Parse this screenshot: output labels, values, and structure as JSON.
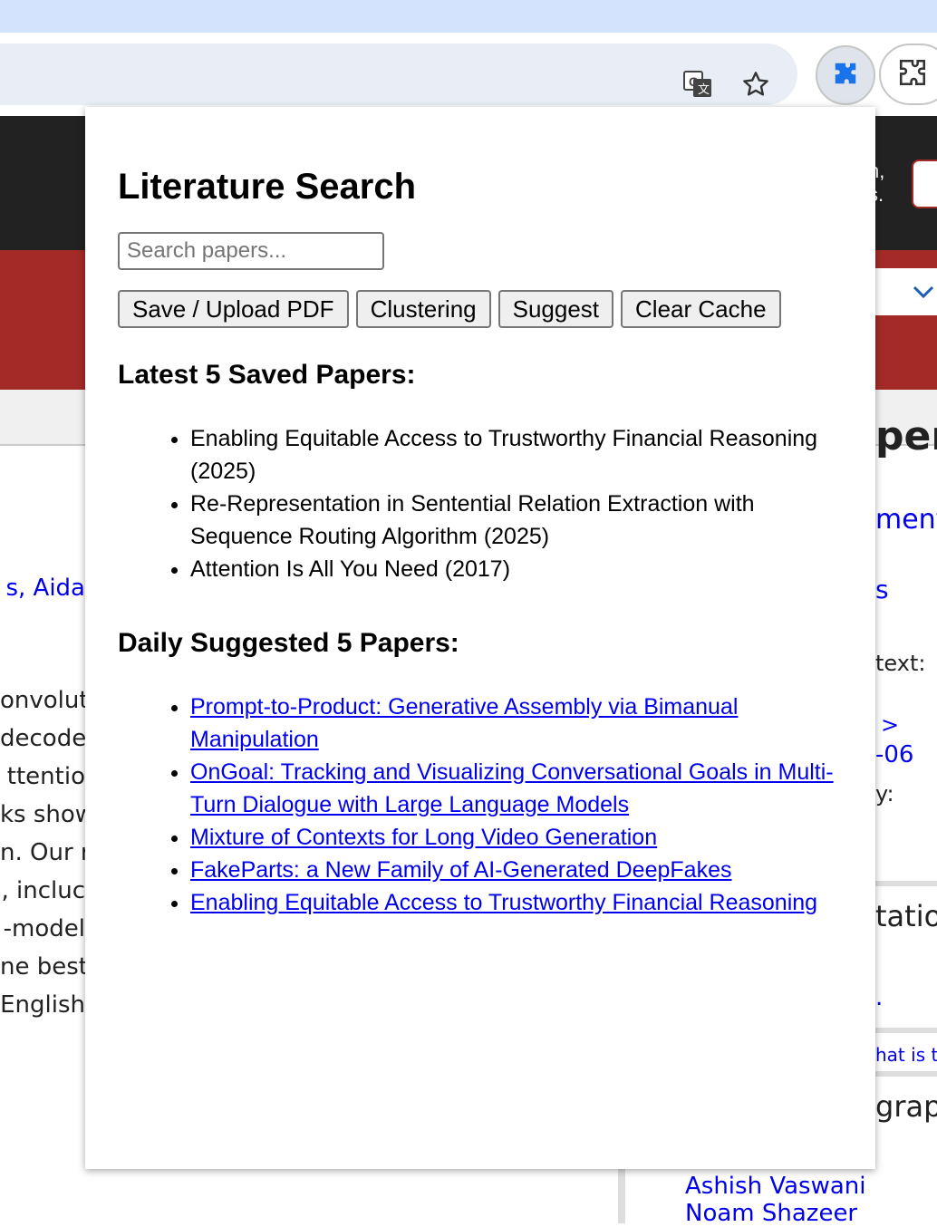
{
  "popup": {
    "title": "Literature Search",
    "search_placeholder": "Search papers...",
    "buttons": [
      "Save / Upload PDF",
      "Clustering",
      "Suggest",
      "Clear Cache"
    ],
    "latest_heading": "Latest 5 Saved Papers:",
    "latest_papers": [
      "Enabling Equitable Access to Trustworthy Financial Reasoning (2025)",
      "Re-Representation in Sentential Relation Extraction with Sequence Routing Algorithm (2025)",
      "Attention Is All You Need (2017)"
    ],
    "daily_heading": "Daily Suggested 5 Papers:",
    "daily_papers": [
      "Prompt-to-Product: Generative Assembly via Bimanual Manipulation",
      "OnGoal: Tracking and Visualizing Conversational Goals in Multi-Turn Dialogue with Large Language Models",
      "Mixture of Contexts for Long Video Generation",
      "FakeParts: a New Family of AI-Generated DeepFakes",
      "Enabling Equitable Access to Trustworthy Financial Reasoning"
    ]
  },
  "background_page": {
    "header_text": [
      "n,",
      "s."
    ],
    "left_fragments": [
      "s, Aida",
      "onvolut",
      "decode",
      "ttentio",
      "ks show",
      "n. Our r",
      ", incluc",
      "-model",
      "ne best",
      "English"
    ],
    "right_fragments": [
      "per:",
      "ment",
      "s",
      "text:",
      ">",
      "-06",
      "y:",
      "tatior",
      ".",
      "hat is t",
      "grap"
    ],
    "authors": [
      "Ashish Vaswani",
      "Noam Shazeer"
    ]
  },
  "toolbar": {
    "icons": [
      "translate-icon",
      "star-icon",
      "extension-puzzle-icon",
      "extensions-menu-icon"
    ]
  },
  "colors": {
    "titlebar": "#d3e3fd",
    "header_dark": "#222222",
    "header_red": "#a32a26",
    "link": "#0000ee"
  }
}
